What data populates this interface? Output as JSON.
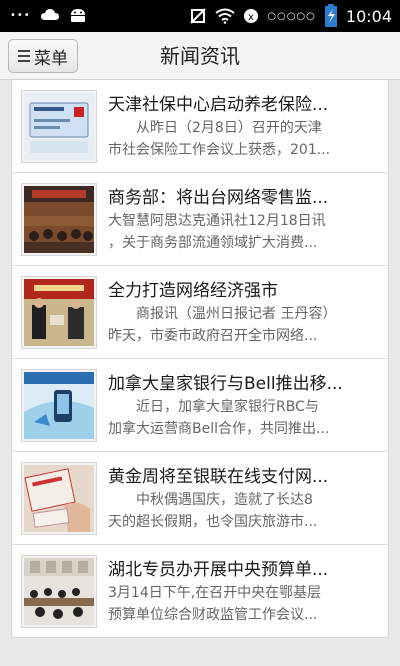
{
  "status_bar": {
    "time": "10:04",
    "notification_dots": "•••",
    "signal_dots": "○○○○○",
    "icons": [
      "dots-icon",
      "cloud-icon",
      "android-icon",
      "mute-icon",
      "wifi-icon",
      "sim-icon",
      "battery-icon"
    ]
  },
  "header": {
    "menu_label": "菜单",
    "title": "新闻资讯"
  },
  "news": [
    {
      "title": "天津社保中心启动养老保险...",
      "summary_line1": "从昨日（2月8日）召开的天津",
      "summary_line2": "市社会保险工作会议上获悉，201..."
    },
    {
      "title": "商务部：将出台网络零售监...",
      "summary_line1": "大智慧阿思达克通讯社12月18日讯",
      "summary_line2": "，关于商务部流通领域扩大消费..."
    },
    {
      "title": "全力打造网络经济强市",
      "summary_line1": "商报讯（温州日报记者 王丹容）",
      "summary_line2": "昨天，市委市政府召开全市网络..."
    },
    {
      "title": "加拿大皇家银行与Bell推出移...",
      "summary_line1": "近日，加拿大皇家银行RBC与",
      "summary_line2": "加拿大运营商Bell合作，共同推出..."
    },
    {
      "title": "黄金周将至银联在线支付网...",
      "summary_line1": "中秋偶遇国庆，造就了长达8",
      "summary_line2": "天的超长假期，也令国庆旅游市..."
    },
    {
      "title": "湖北专员办开展中央预算单...",
      "summary_line1": "3月14日下午,在召开中央在鄂基层",
      "summary_line2": "预算单位综合财政监管工作会议..."
    }
  ]
}
